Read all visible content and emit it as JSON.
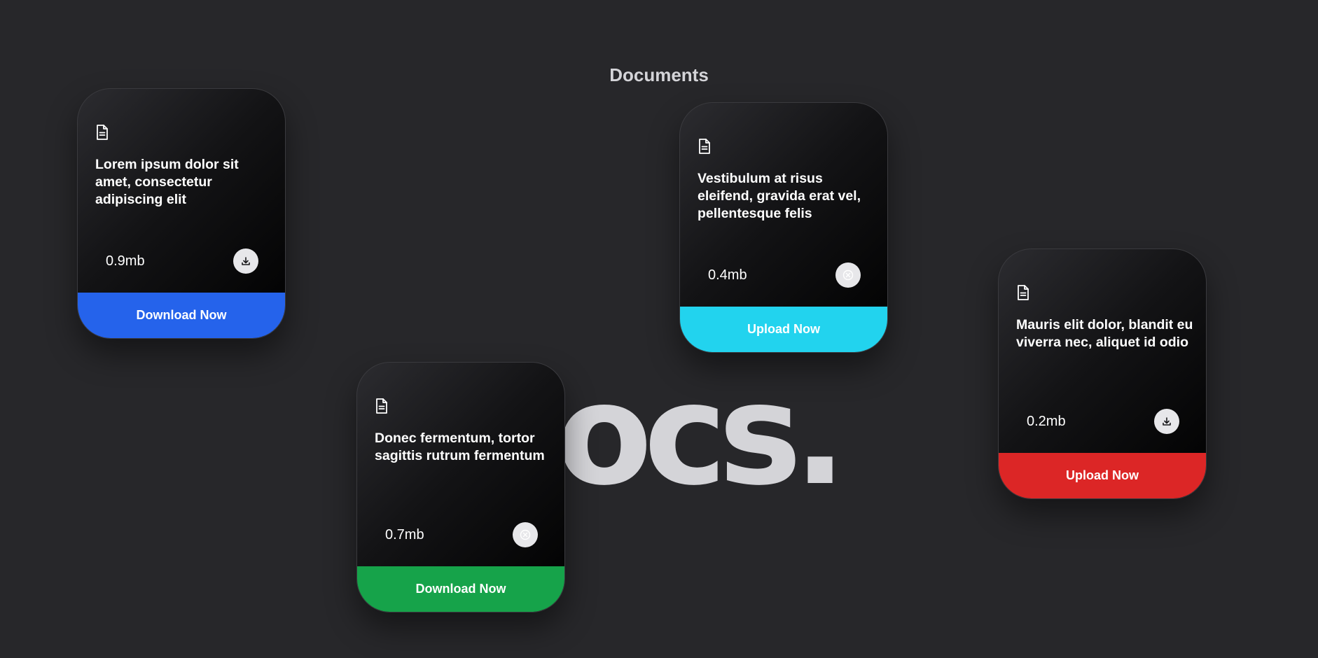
{
  "page": {
    "title": "Documents",
    "watermark": "Docs."
  },
  "colors": {
    "background": "#27272a",
    "blue": "#2563eb",
    "cyan": "#22d3ee",
    "green": "#16a34a",
    "red": "#dc2626"
  },
  "cards": [
    {
      "icon": "document-icon",
      "title": "Lorem ipsum dolor sit amet, consectetur adipiscing elit",
      "size": "0.9mb",
      "action_icon": "download-icon",
      "button_label": "Download Now",
      "button_color": "#2563eb"
    },
    {
      "icon": "document-icon",
      "title": "Vestibulum at risus eleifend, gravida erat vel, pellentesque felis",
      "size": "0.4mb",
      "action_icon": "close-circle-icon",
      "button_label": "Upload Now",
      "button_color": "#22d3ee"
    },
    {
      "icon": "document-icon",
      "title": "Mauris elit dolor, blandit eu viverra nec, aliquet id odio",
      "size": "0.2mb",
      "action_icon": "download-icon",
      "button_label": "Upload Now",
      "button_color": "#dc2626"
    },
    {
      "icon": "document-icon",
      "title": "Donec fermentum, tortor sagittis rutrum fermentum",
      "size": "0.7mb",
      "action_icon": "close-circle-icon",
      "button_label": "Download Now",
      "button_color": "#16a34a"
    }
  ]
}
